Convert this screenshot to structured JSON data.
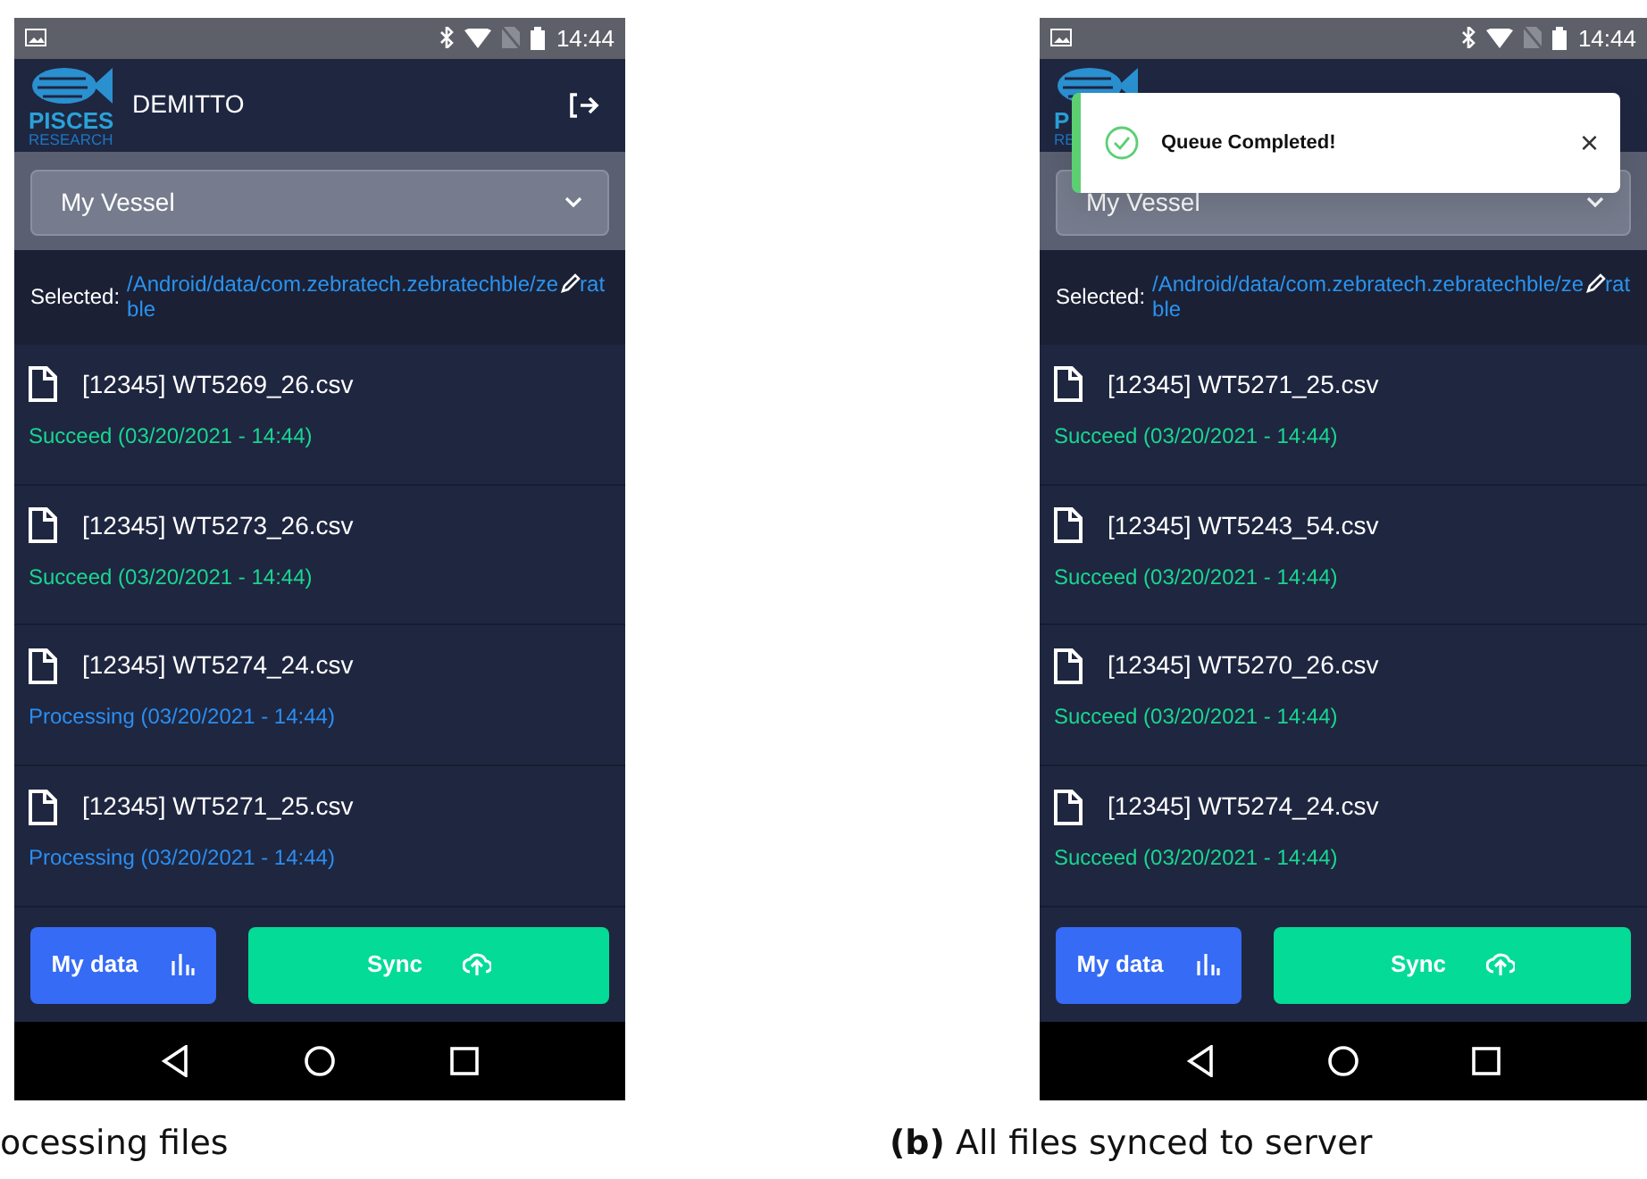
{
  "phones": [
    {
      "status_bar": {
        "time": "14:44"
      },
      "header": {
        "logo_lines": [
          "PISCES",
          "RESEARCH"
        ],
        "title": "DEMITTO",
        "logout": true
      },
      "vessel": {
        "value": "My Vessel"
      },
      "selected": {
        "label": "Selected:",
        "path_start": "/Android/data/com.zebratech.zebratechble/ze",
        "path_cut": "rat",
        "path_end": "ble"
      },
      "files": [
        {
          "name": "[12345] WT5269_26.csv",
          "status": "Succeed (03/20/2021 - 14:44)",
          "kind": "succeed"
        },
        {
          "name": "[12345] WT5273_26.csv",
          "status": "Succeed (03/20/2021 - 14:44)",
          "kind": "succeed"
        },
        {
          "name": "[12345] WT5274_24.csv",
          "status": "Processing (03/20/2021 - 14:44)",
          "kind": "processing"
        },
        {
          "name": "[12345] WT5271_25.csv",
          "status": "Processing (03/20/2021 - 14:44)",
          "kind": "processing"
        }
      ],
      "buttons": {
        "my_data": "My data",
        "sync": "Sync"
      }
    },
    {
      "status_bar": {
        "time": "14:44"
      },
      "header": {
        "logo_lines": [
          "P",
          "RE"
        ]
      },
      "toast": {
        "message": "Queue Completed!",
        "close": "×"
      },
      "vessel": {
        "value": "My Vessel"
      },
      "selected": {
        "label": "Selected:",
        "path_start": "/Android/data/com.zebratech.zebratechble/ze",
        "path_cut": "rat",
        "path_end": "ble"
      },
      "files": [
        {
          "name": "[12345] WT5271_25.csv",
          "status": "Succeed (03/20/2021 - 14:44)",
          "kind": "succeed"
        },
        {
          "name": "[12345] WT5243_54.csv",
          "status": "Succeed (03/20/2021 - 14:44)",
          "kind": "succeed"
        },
        {
          "name": "[12345] WT5270_26.csv",
          "status": "Succeed (03/20/2021 - 14:44)",
          "kind": "succeed"
        },
        {
          "name": "[12345] WT5274_24.csv",
          "status": "Succeed (03/20/2021 - 14:44)",
          "kind": "succeed"
        }
      ],
      "buttons": {
        "my_data": "My data",
        "sync": "Sync"
      }
    }
  ],
  "captions": [
    "ocessing files",
    "**(b)** All files synced to server"
  ]
}
